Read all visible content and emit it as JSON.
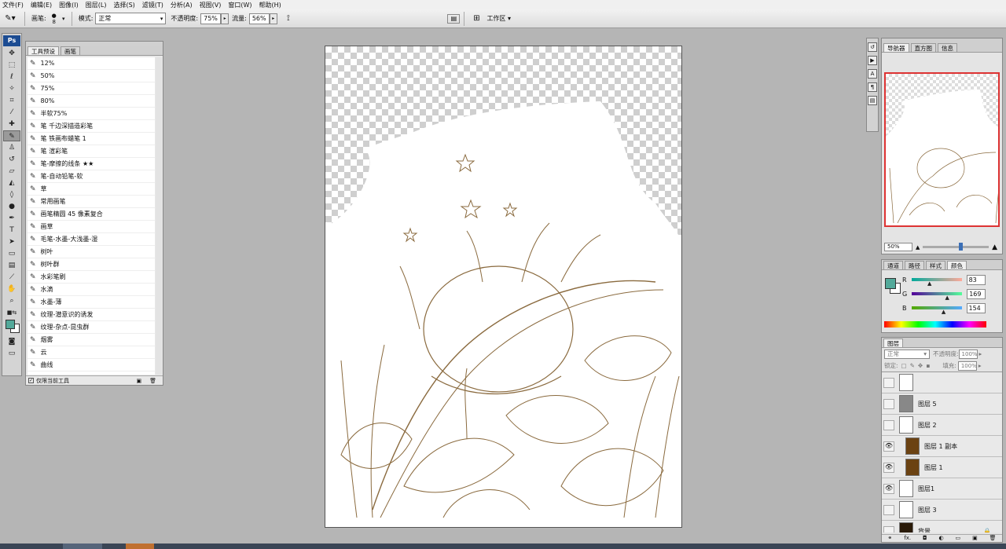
{
  "menu": [
    "文件(F)",
    "编辑(E)",
    "图像(I)",
    "图层(L)",
    "选择(S)",
    "滤镜(T)",
    "分析(A)",
    "视图(V)",
    "窗口(W)",
    "帮助(H)"
  ],
  "options": {
    "brush_label": "画笔:",
    "brush_size": "8",
    "mode_label": "模式:",
    "mode_value": "正常",
    "opacity_label": "不透明度:",
    "opacity_value": "75%",
    "flow_label": "流量:",
    "flow_value": "56%",
    "workspace_label": "工作区 ▾"
  },
  "tool_presets": {
    "tabs": [
      "工具预设",
      "画笔"
    ],
    "items": [
      "12%",
      "50%",
      "75%",
      "80%",
      "半软75%",
      "笔 千边深描造彩笔",
      "笔 铁画布蜡笔 1",
      "笔 渲彩笔",
      "笔-摩擦的线条 ★★",
      "笔-自动铅笔-软",
      "草",
      "常用画笔",
      "画笔精圆 45 像素复合",
      "画草",
      "毛笔-水墨-大浅墨-湿",
      "树叶",
      "树叶群",
      "水彩笔刷",
      "水滴",
      "水墨-薄",
      "纹理-潜意识的诱发",
      "纹理-杂点-昆虫群",
      "烟雾",
      "云",
      "曲线"
    ],
    "footer_checkbox": "仅限当前工具"
  },
  "navigator": {
    "tabs": [
      "导航器",
      "直方图",
      "信息"
    ],
    "zoom": "50%"
  },
  "color": {
    "tabs": [
      "通道",
      "路径",
      "样式",
      "颜色"
    ],
    "r_label": "R",
    "r": "83",
    "g_label": "G",
    "g": "169",
    "b_label": "B",
    "b": "154",
    "fg_color": "#53a99a"
  },
  "layers": {
    "tab": "图层",
    "blend_mode": "正常",
    "opacity_label": "不透明度:",
    "opacity": "100%",
    "lock_label": "锁定:",
    "fill_label": "填充:",
    "fill": "100%",
    "items": [
      {
        "name": "",
        "visible": false
      },
      {
        "name": "图层 5",
        "visible": false
      },
      {
        "name": "图层 2",
        "visible": false
      },
      {
        "name": "图层 1 副本",
        "visible": true
      },
      {
        "name": "图层 1",
        "visible": true
      },
      {
        "name": "图层1",
        "visible": true
      },
      {
        "name": "图层 3",
        "visible": false
      },
      {
        "name": "背景",
        "visible": false
      }
    ]
  },
  "colors": {
    "sketch": "#8a6a3e",
    "accent": "#1c4c92",
    "layer_brown": "#6b4212"
  }
}
